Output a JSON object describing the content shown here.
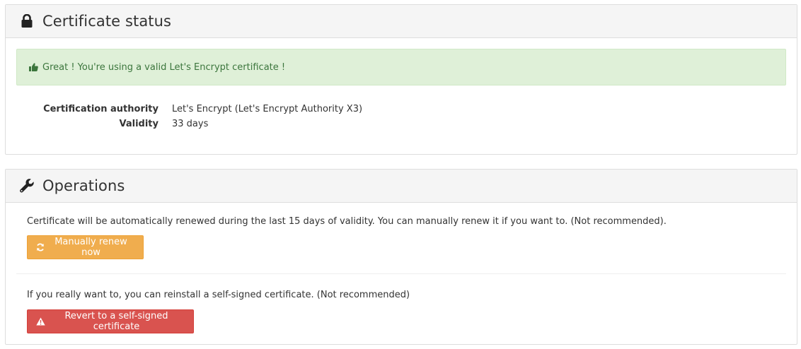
{
  "certificate_panel": {
    "title": "Certificate status",
    "alert": "Great ! You're using a valid Let's Encrypt certificate !",
    "details": [
      {
        "label": "Certification authority",
        "value": "Let's Encrypt (Let's Encrypt Authority X3)"
      },
      {
        "label": "Validity",
        "value": "33 days"
      }
    ]
  },
  "operations_panel": {
    "title": "Operations",
    "renew_text": "Certificate will be automatically renewed during the last 15 days of validity. You can manually renew it if you want to. (Not recommended).",
    "renew_button": "Manually renew now",
    "revert_text": "If you really want to, you can reinstall a self-signed certificate. (Not recommended)",
    "revert_button": "Revert to a self-signed certificate"
  },
  "colors": {
    "success_bg": "#dff0d8",
    "success_text": "#3c763d",
    "warning": "#f0ad4e",
    "danger": "#d9534f"
  },
  "icons": {
    "certificate_heading": "lock-icon",
    "alert": "thumbs-up-icon",
    "operations_heading": "wrench-icon",
    "renew_button": "refresh-icon",
    "revert_button": "warning-icon"
  }
}
